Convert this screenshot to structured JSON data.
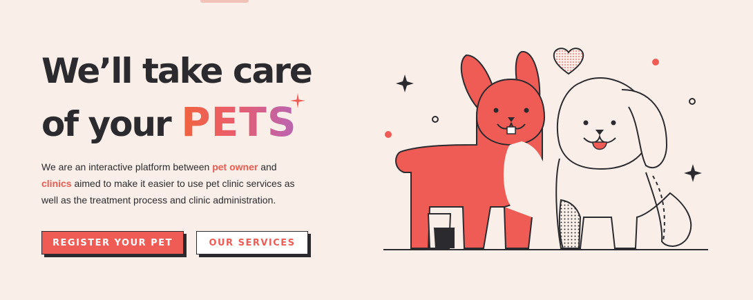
{
  "hero": {
    "title_line1": "We’ll take care",
    "title_line2_prefix": "of your ",
    "title_highlight": "PETS",
    "description_part1": "We are an interactive platform between ",
    "description_hl1": "pet owner",
    "description_part2": " and ",
    "description_hl2": "clinics",
    "description_part3": " aimed to make it easier to use pet clinic services as well as the treatment process and clinic administration."
  },
  "buttons": {
    "register_label": "REGISTER YOUR PET",
    "services_label": "OUR SERVICES"
  },
  "colors": {
    "background": "#f9efe8",
    "accent": "#ef5c56",
    "text": "#2b2a2e",
    "gradient_start": "#f0643e",
    "gradient_end": "#b865b5"
  },
  "illustration": {
    "icons": [
      "corgi-dog-icon",
      "white-puppy-icon",
      "heart-icon",
      "sparkle-icon",
      "dot-icon"
    ]
  }
}
